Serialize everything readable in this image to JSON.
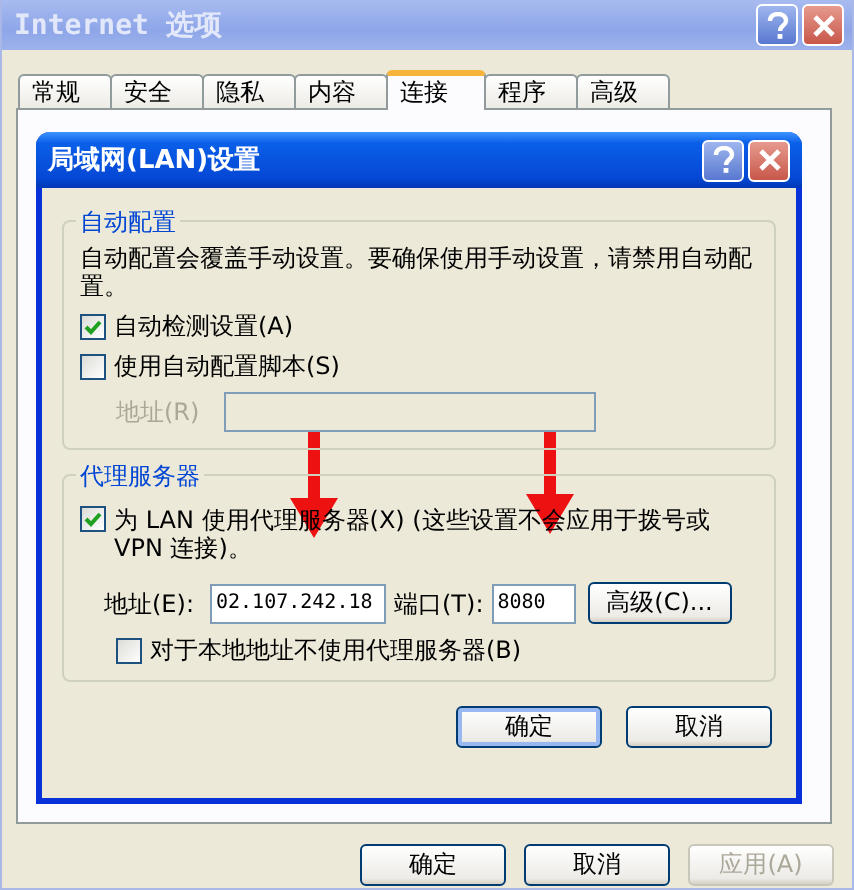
{
  "window": {
    "title": "Internet 选项"
  },
  "tabs": [
    {
      "label": "常规",
      "selected": false
    },
    {
      "label": "安全",
      "selected": false
    },
    {
      "label": "隐私",
      "selected": false
    },
    {
      "label": "内容",
      "selected": false
    },
    {
      "label": "连接",
      "selected": true
    },
    {
      "label": "程序",
      "selected": false
    },
    {
      "label": "高级",
      "selected": false
    }
  ],
  "dialog": {
    "title": "局域网(LAN)设置",
    "auto_config": {
      "title": "自动配置",
      "description": "自动配置会覆盖手动设置。要确保使用手动设置，请禁用自动配置。",
      "options": [
        {
          "label": "自动检测设置(A)",
          "checked": true
        },
        {
          "label": "使用自动配置脚本(S)",
          "checked": false
        }
      ],
      "address": {
        "label": "地址(R)",
        "disabled": true
      }
    },
    "proxy": {
      "title": "代理服务器",
      "use_proxy": {
        "label": "为 LAN 使用代理服务器(X) (这些设置不会应用于拨号或 VPN 连接)。",
        "checked": true
      },
      "address": {
        "label": "地址(E):",
        "value": "02.107.242.18"
      },
      "port": {
        "label": "端口(T):",
        "value": "8080"
      },
      "advanced_button": "高级(C)...",
      "bypass_local": {
        "label": "对于本地地址不使用代理服务器(B)",
        "checked": false
      }
    },
    "buttons": [
      {
        "label": "确定",
        "default": true
      },
      {
        "label": "取消",
        "default": false
      }
    ]
  },
  "buttons": [
    {
      "label": "确定",
      "disabled": false
    },
    {
      "label": "取消",
      "disabled": false
    },
    {
      "label": "应用(A)",
      "disabled": true
    }
  ]
}
